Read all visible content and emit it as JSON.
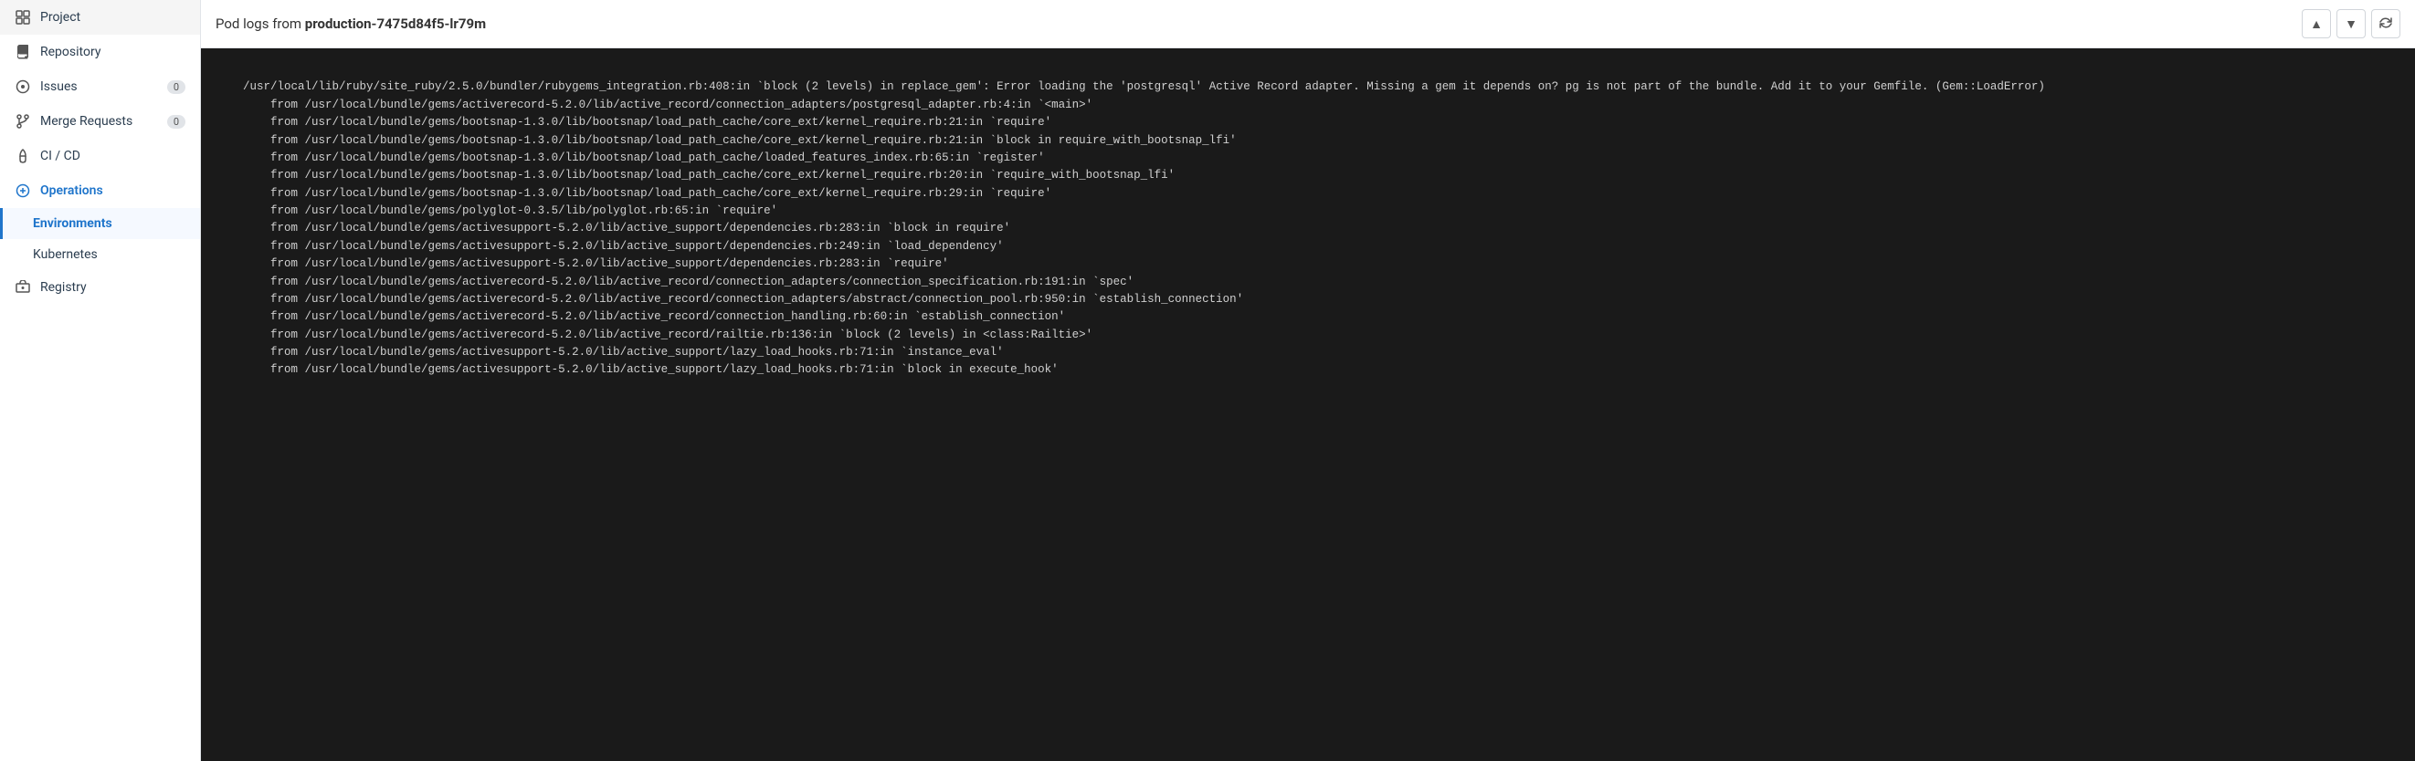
{
  "sidebar": {
    "items": [
      {
        "id": "project",
        "label": "Project",
        "icon": "home-icon",
        "badge": null
      },
      {
        "id": "repository",
        "label": "Repository",
        "icon": "book-icon",
        "badge": null
      },
      {
        "id": "issues",
        "label": "Issues",
        "icon": "issues-icon",
        "badge": "0"
      },
      {
        "id": "merge-requests",
        "label": "Merge Requests",
        "icon": "merge-icon",
        "badge": "0"
      },
      {
        "id": "ci-cd",
        "label": "CI / CD",
        "icon": "rocket-icon",
        "badge": null
      },
      {
        "id": "operations",
        "label": "Operations",
        "icon": "operations-icon",
        "badge": null,
        "active": true
      },
      {
        "id": "registry",
        "label": "Registry",
        "icon": "registry-icon",
        "badge": null
      }
    ],
    "sub_items": [
      {
        "id": "environments",
        "label": "Environments",
        "active": true
      },
      {
        "id": "kubernetes",
        "label": "Kubernetes",
        "active": false
      }
    ]
  },
  "header": {
    "prefix": "Pod logs from ",
    "pod_name": "production-7475d84f5-lr79m"
  },
  "log_content": "/usr/local/lib/ruby/site_ruby/2.5.0/bundler/rubygems_integration.rb:408:in `block (2 levels) in replace_gem': Error loading the 'postgresql' Active Record adapter. Missing a gem it depends on? pg is not part of the bundle. Add it to your Gemfile. (Gem::LoadError)\n\tfrom /usr/local/bundle/gems/activerecord-5.2.0/lib/active_record/connection_adapters/postgresql_adapter.rb:4:in `<main>'\n\tfrom /usr/local/bundle/gems/bootsnap-1.3.0/lib/bootsnap/load_path_cache/core_ext/kernel_require.rb:21:in `require'\n\tfrom /usr/local/bundle/gems/bootsnap-1.3.0/lib/bootsnap/load_path_cache/core_ext/kernel_require.rb:21:in `block in require_with_bootsnap_lfi'\n\tfrom /usr/local/bundle/gems/bootsnap-1.3.0/lib/bootsnap/load_path_cache/loaded_features_index.rb:65:in `register'\n\tfrom /usr/local/bundle/gems/bootsnap-1.3.0/lib/bootsnap/load_path_cache/core_ext/kernel_require.rb:20:in `require_with_bootsnap_lfi'\n\tfrom /usr/local/bundle/gems/bootsnap-1.3.0/lib/bootsnap/load_path_cache/core_ext/kernel_require.rb:29:in `require'\n\tfrom /usr/local/bundle/gems/polyglot-0.3.5/lib/polyglot.rb:65:in `require'\n\tfrom /usr/local/bundle/gems/activesupport-5.2.0/lib/active_support/dependencies.rb:283:in `block in require'\n\tfrom /usr/local/bundle/gems/activesupport-5.2.0/lib/active_support/dependencies.rb:249:in `load_dependency'\n\tfrom /usr/local/bundle/gems/activesupport-5.2.0/lib/active_support/dependencies.rb:283:in `require'\n\tfrom /usr/local/bundle/gems/activerecord-5.2.0/lib/active_record/connection_adapters/connection_specification.rb:191:in `spec'\n\tfrom /usr/local/bundle/gems/activerecord-5.2.0/lib/active_record/connection_adapters/abstract/connection_pool.rb:950:in `establish_connection'\n\tfrom /usr/local/bundle/gems/activerecord-5.2.0/lib/active_record/connection_handling.rb:60:in `establish_connection'\n\tfrom /usr/local/bundle/gems/activerecord-5.2.0/lib/active_record/railtie.rb:136:in `block (2 levels) in <class:Railtie>'\n\tfrom /usr/local/bundle/gems/activesupport-5.2.0/lib/active_support/lazy_load_hooks.rb:71:in `instance_eval'\n\tfrom /usr/local/bundle/gems/activesupport-5.2.0/lib/active_support/lazy_load_hooks.rb:71:in `block in execute_hook'",
  "actions": {
    "scroll_top_label": "▲",
    "scroll_bottom_label": "▼",
    "refresh_label": "↻"
  }
}
